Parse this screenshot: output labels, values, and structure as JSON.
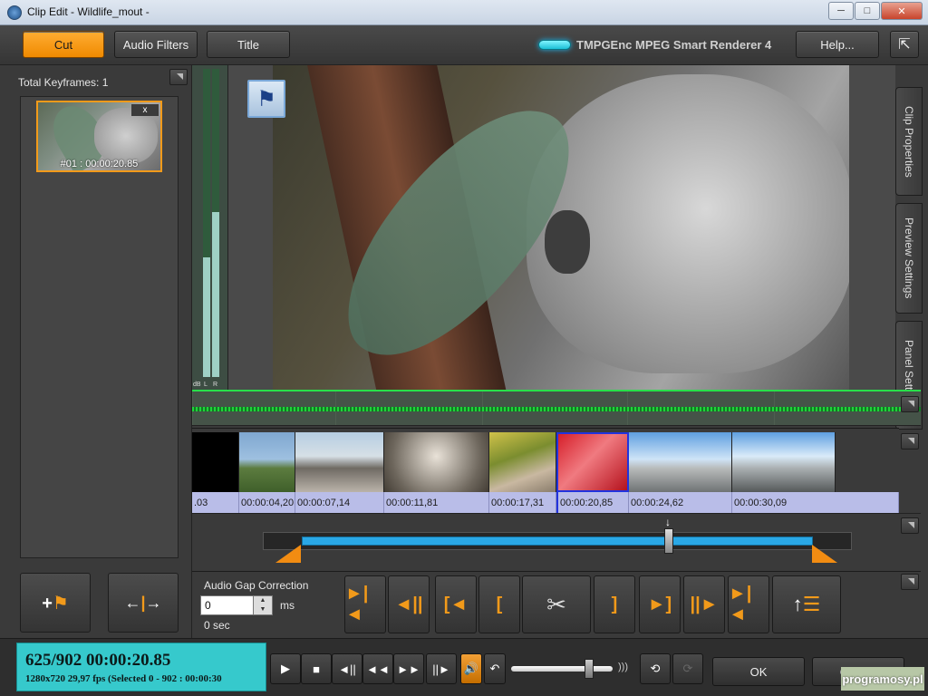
{
  "window": {
    "title": "Clip Edit - Wildlife_mout -",
    "controls": [
      "minimize",
      "maximize",
      "close"
    ]
  },
  "toolbar": {
    "tabs": [
      {
        "label": "Cut",
        "active": true
      },
      {
        "label": "Audio Filters",
        "active": false
      },
      {
        "label": "Title",
        "active": false
      }
    ],
    "brand": "TMPGEnc MPEG Smart Renderer 4",
    "help_label": "Help...",
    "accent_color": "#f29a1a"
  },
  "keyframes": {
    "title": "Total Keyframes: 1",
    "items": [
      {
        "label": "#01 : 00:00:20.85",
        "remove_label": "x"
      }
    ],
    "add_icon": "add-keyframe-icon",
    "goto_icon": "goto-keyframe-icon"
  },
  "meter": {
    "labels": [
      "dB",
      "L",
      "R"
    ],
    "left_level": 0.4,
    "right_level": 0.55
  },
  "side_tabs": [
    "Clip Properties",
    "Preview Settings",
    "Panel Settings"
  ],
  "strip": {
    "timecodes": [
      ".03",
      "00:00:04,20",
      "00:00:07,14",
      "00:00:11,81",
      "00:00:17,31",
      "00:00:20,85",
      "00:00:24,62",
      "00:00:30,09"
    ],
    "selected_index": 5
  },
  "timeline": {
    "cursor_fraction": 0.69,
    "selection_start": 0,
    "selection_end": 902
  },
  "audio_gap": {
    "title": "Audio Gap Correction",
    "value": "0",
    "unit": "ms",
    "seconds": "0 sec"
  },
  "edit_buttons": [
    "prev-cut-icon",
    "prev-frame-icon",
    "goto-start-icon",
    "set-start-icon",
    "cut-scissors-icon",
    "set-end-icon",
    "goto-end-icon",
    "next-frame-icon",
    "next-cut-icon",
    "cut-list-icon"
  ],
  "status": {
    "position": "625/902 00:00:20.85",
    "info": "1280x720 29,97 fps (Selected 0 - 902 : 00:00:30"
  },
  "playback": [
    "play",
    "stop",
    "step-back",
    "rewind",
    "fast-forward",
    "step-forward"
  ],
  "volume": {
    "level": 0.78
  },
  "dialog": {
    "ok_label": "OK",
    "cancel_label": "Cancel"
  },
  "watermark": "programosy.pl"
}
